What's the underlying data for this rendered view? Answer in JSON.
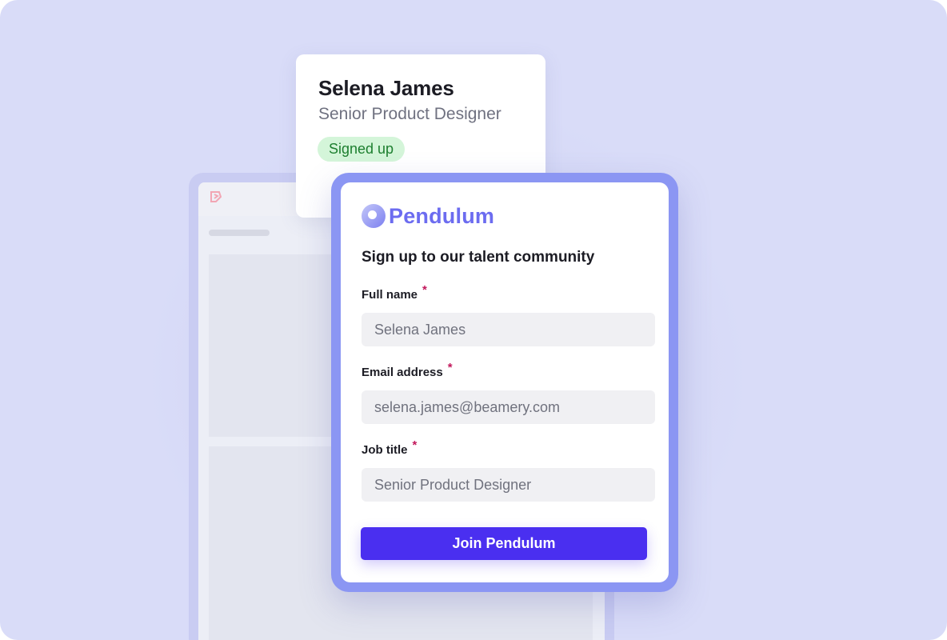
{
  "profile_card": {
    "name": "Selena James",
    "role": "Senior Product Designer",
    "status": "Signed up"
  },
  "form": {
    "brand": "Pendulum",
    "heading": "Sign up to our talent community",
    "required_marker": "*",
    "fields": [
      {
        "label": "Full name",
        "value": "Selena James"
      },
      {
        "label": "Email address",
        "value": "selena.james@beamery.com"
      },
      {
        "label": "Job title",
        "value": "Senior Product Designer"
      }
    ],
    "submit_label": "Join Pendulum"
  },
  "colors": {
    "background": "#d9dcf8",
    "frame": "#8b96f3",
    "brand": "#6c6cf0",
    "button": "#4a2ff0",
    "badge_bg": "#d4f5d9",
    "badge_text": "#1d7f2f",
    "required": "#c2185b"
  },
  "icons": {
    "brand_logo": "pendulum-logo-icon",
    "app_logo": "app-logo-icon"
  }
}
